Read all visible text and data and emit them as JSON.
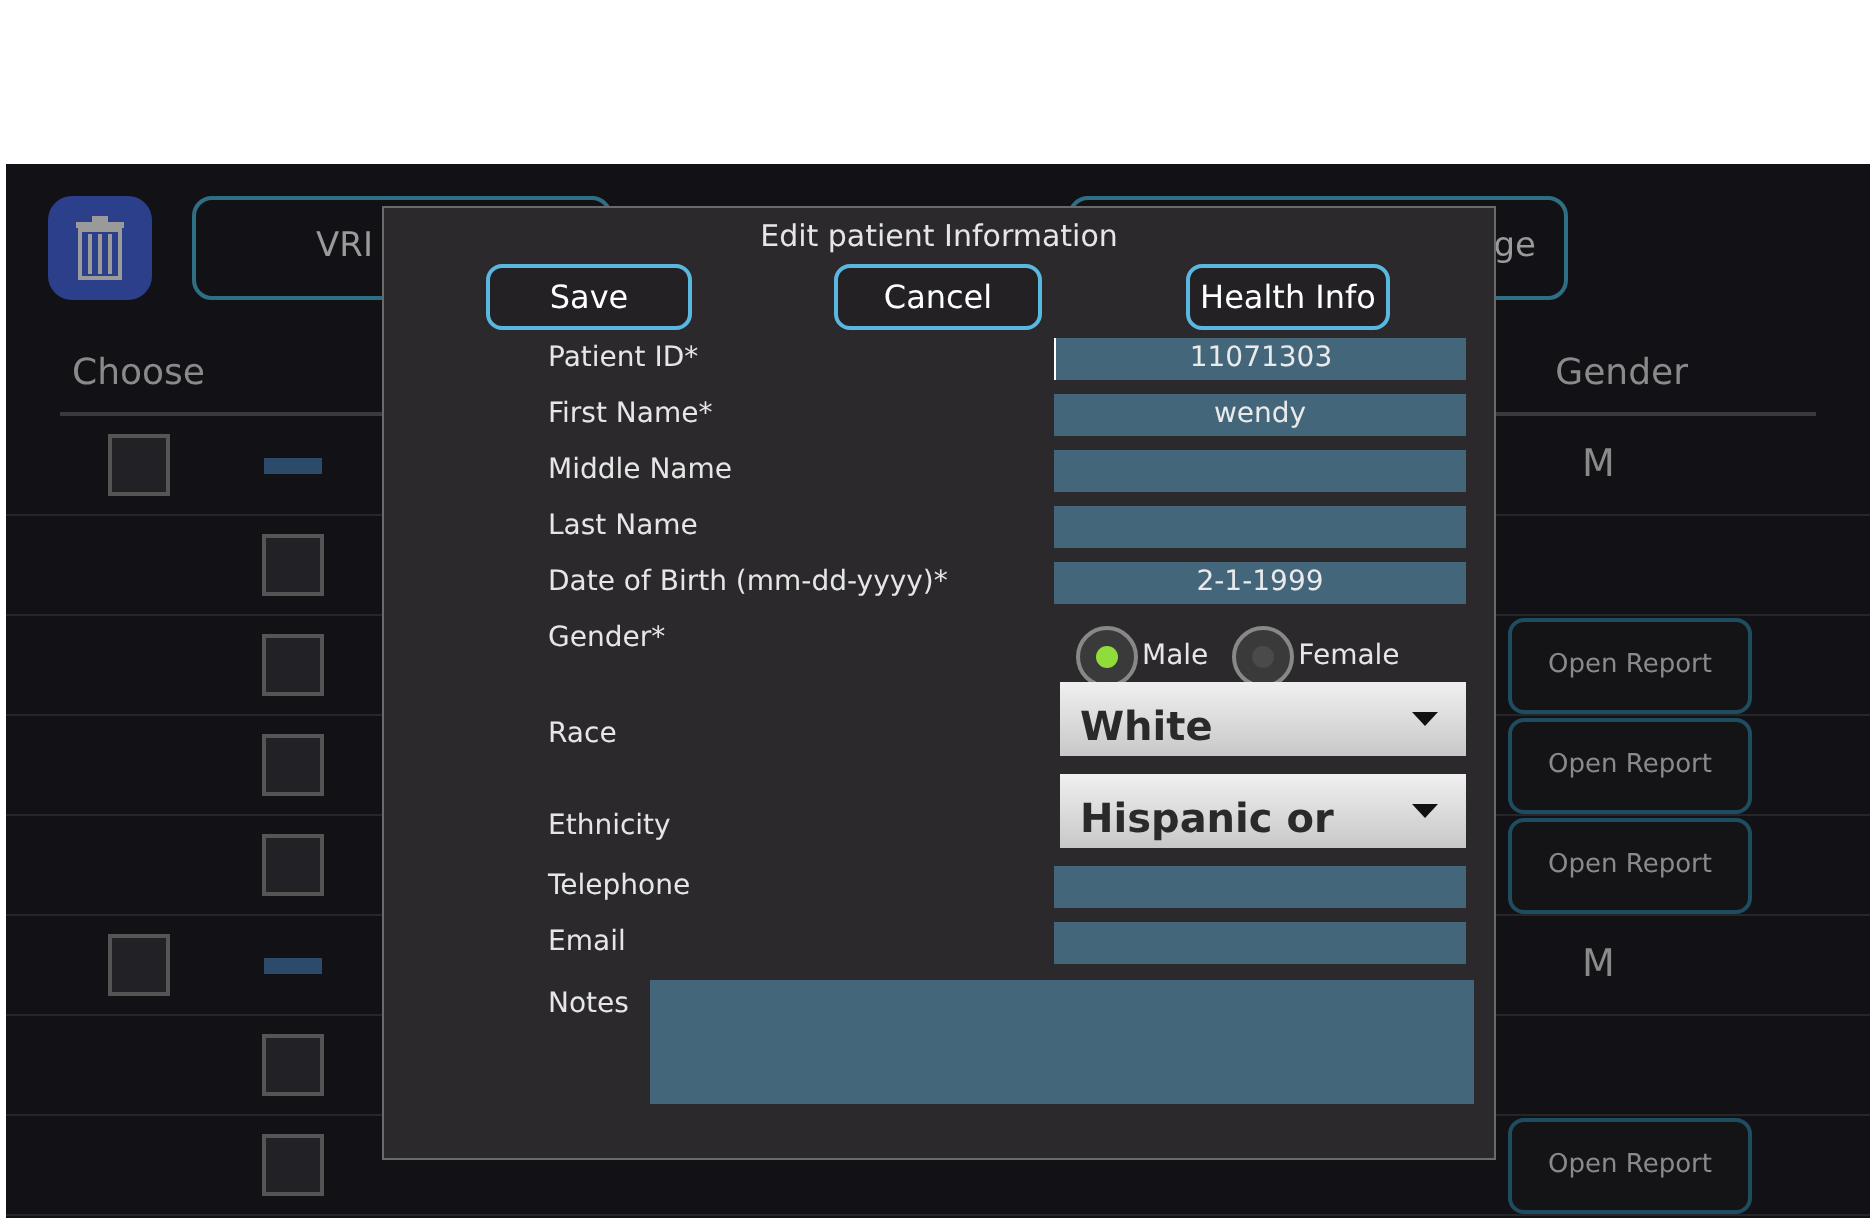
{
  "toolbar": {
    "buttons": [
      "VRI",
      "ge"
    ]
  },
  "table": {
    "columns": [
      "Choose",
      "Gender"
    ],
    "rows": [
      {
        "kind": "patient",
        "checked": false,
        "gender": "M"
      },
      {
        "kind": "exam",
        "checked": false
      },
      {
        "kind": "exam",
        "checked": false,
        "action": "Open Report"
      },
      {
        "kind": "exam",
        "checked": false,
        "action": "Open Report"
      },
      {
        "kind": "exam",
        "checked": false,
        "action": "Open Report"
      },
      {
        "kind": "patient",
        "checked": false,
        "gender": "M"
      },
      {
        "kind": "exam",
        "checked": false
      },
      {
        "kind": "exam",
        "checked": false,
        "action": "Open Report"
      }
    ]
  },
  "dialog": {
    "title": "Edit patient Information",
    "buttons": [
      "Save",
      "Cancel",
      "Health Info"
    ],
    "fields": [
      {
        "kind": "text",
        "label": "Patient ID*",
        "value": "11071303",
        "focused": true
      },
      {
        "kind": "text",
        "label": "First Name*",
        "value": "wendy"
      },
      {
        "kind": "text",
        "label": "Middle Name"
      },
      {
        "kind": "text",
        "label": "Last Name"
      },
      {
        "kind": "text",
        "label": "Date of Birth (mm-dd-yyyy)*",
        "value": "2-1-1999"
      },
      {
        "kind": "radio",
        "label": "Gender*",
        "options": [
          {
            "label": "Male",
            "selected": true
          },
          {
            "label": "Female",
            "selected": false
          }
        ]
      },
      {
        "kind": "dropdown",
        "label": "Race",
        "value": "White"
      },
      {
        "kind": "dropdown",
        "label": "Ethnicity",
        "value": "Hispanic or"
      },
      {
        "kind": "text",
        "label": "Telephone"
      },
      {
        "kind": "text",
        "label": "Email"
      },
      {
        "kind": "textarea",
        "label": "Notes"
      }
    ]
  }
}
